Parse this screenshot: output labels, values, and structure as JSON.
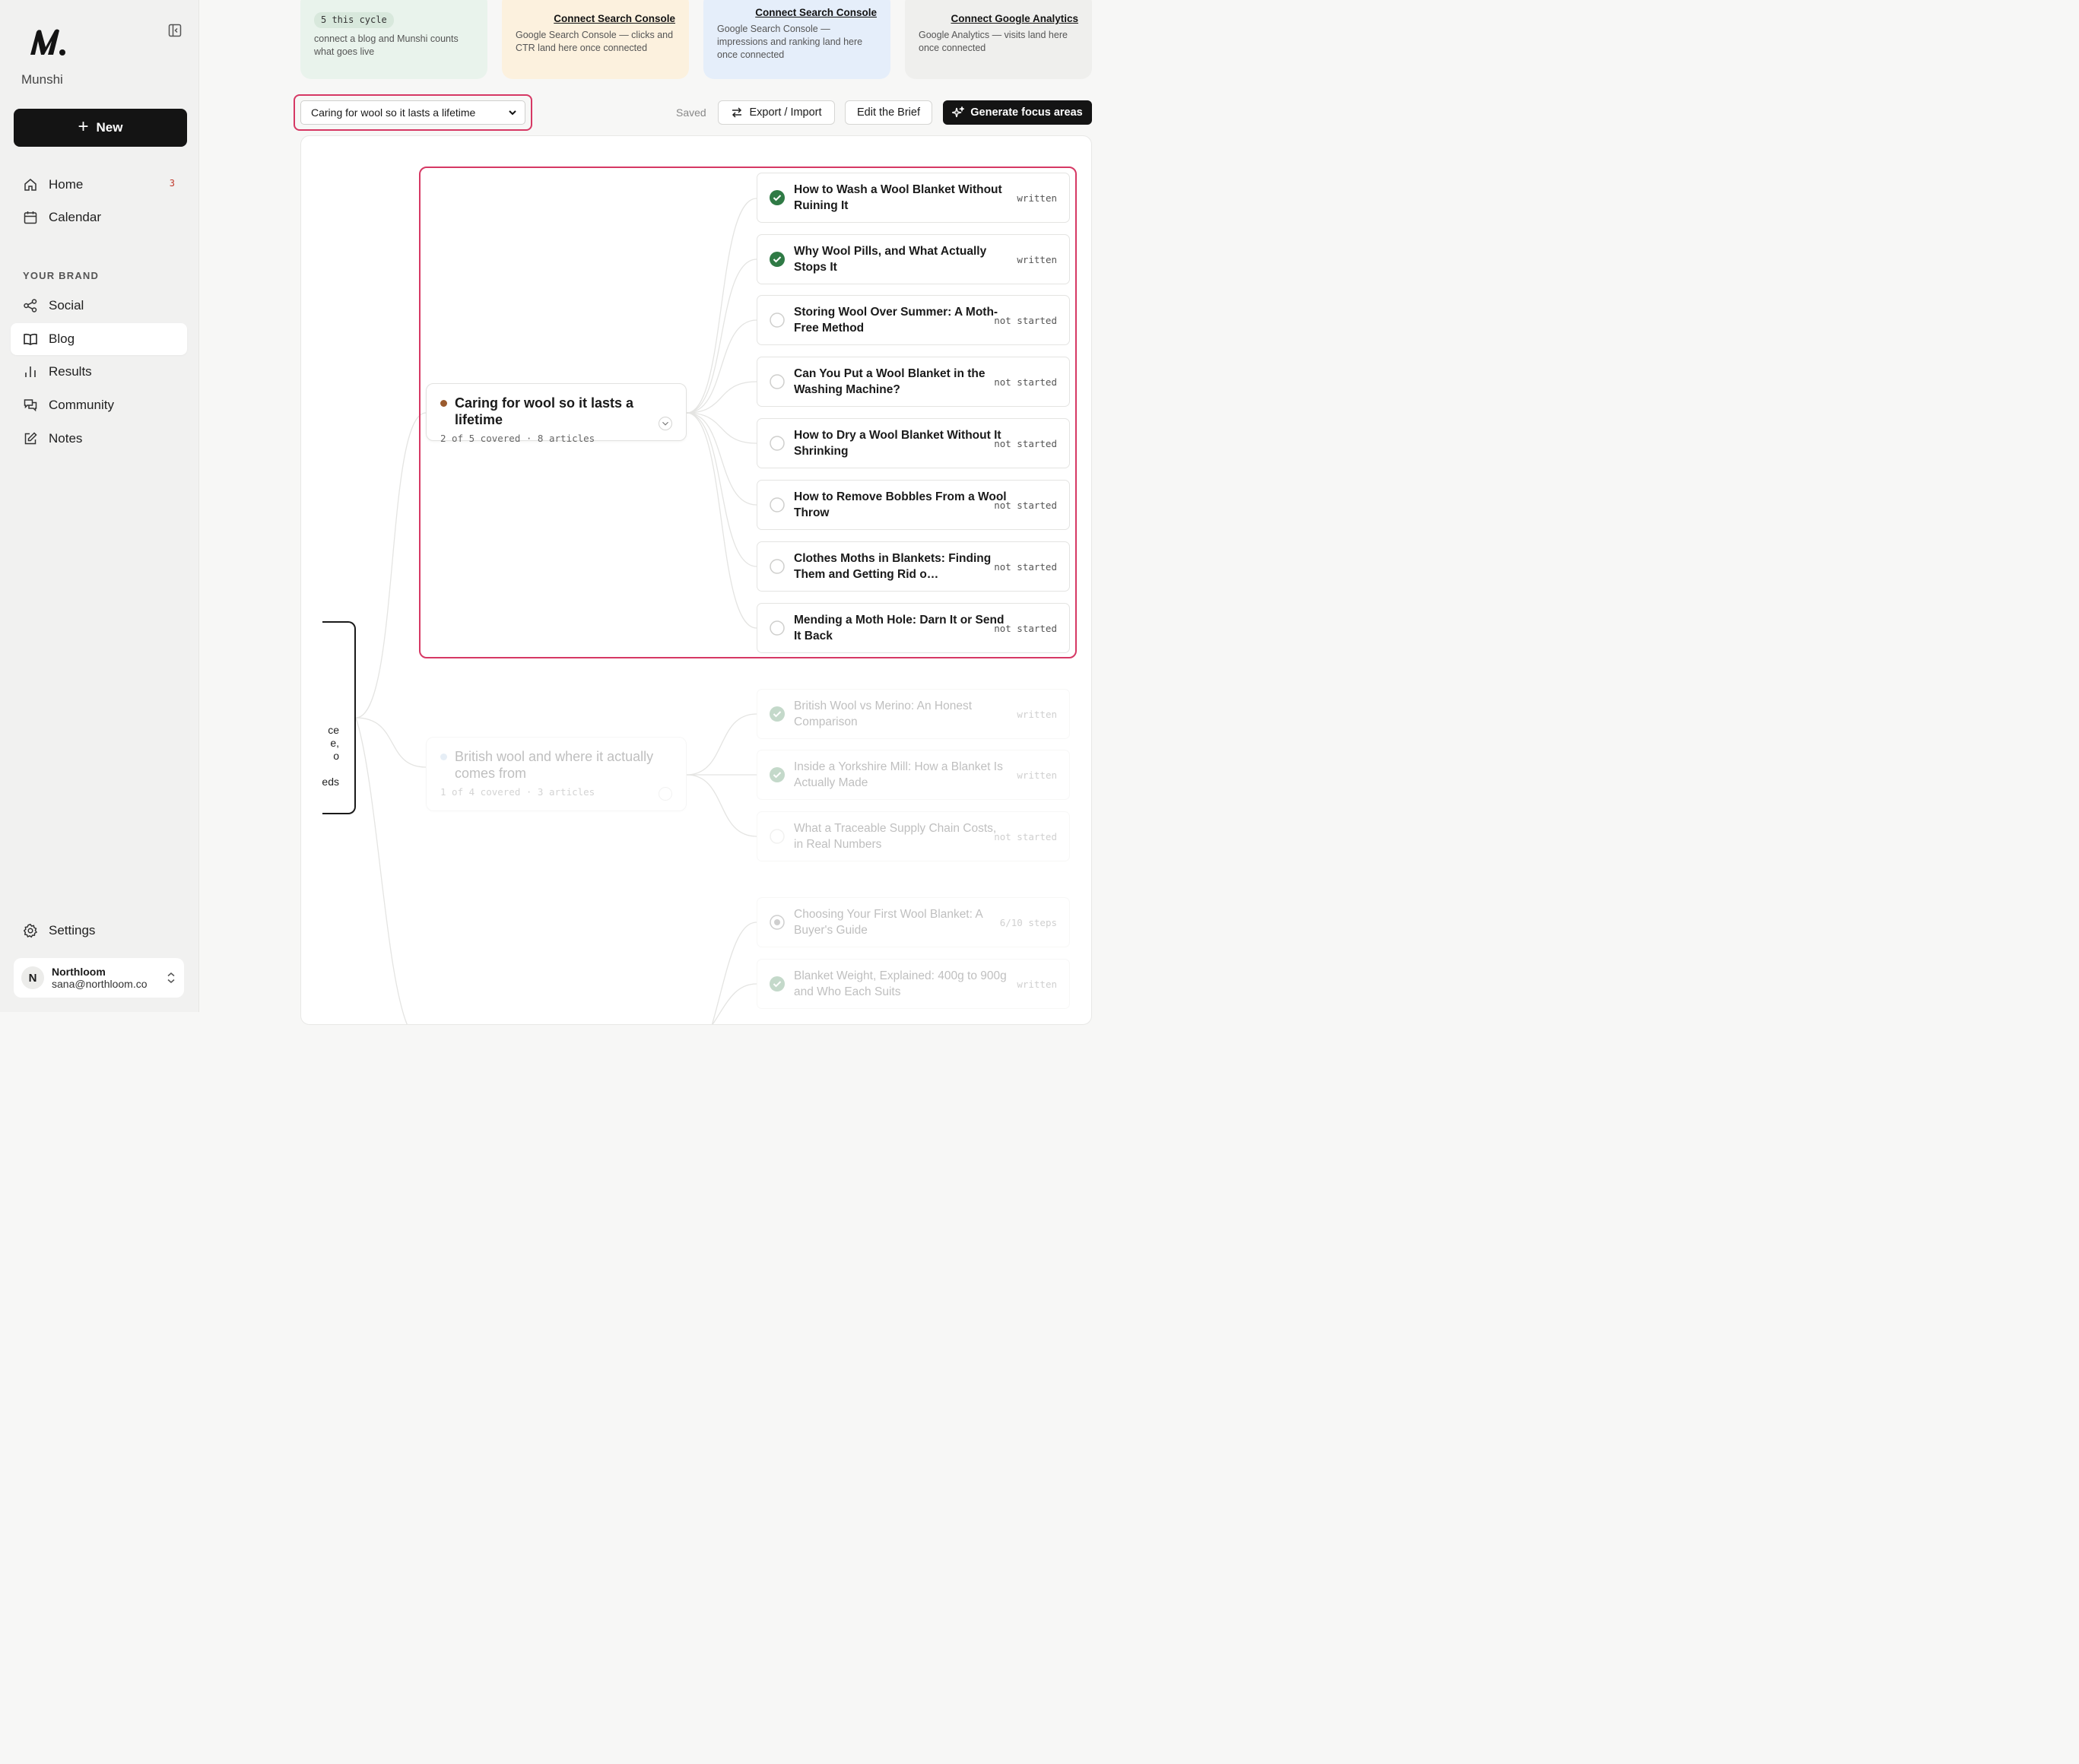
{
  "brand": {
    "name": "Munshi"
  },
  "sidebar": {
    "new_label": "New",
    "home": {
      "label": "Home",
      "badge": "3"
    },
    "calendar": {
      "label": "Calendar"
    },
    "section_label": "YOUR BRAND",
    "social": {
      "label": "Social"
    },
    "blog": {
      "label": "Blog"
    },
    "results": {
      "label": "Results"
    },
    "community": {
      "label": "Community"
    },
    "notes": {
      "label": "Notes"
    },
    "settings": {
      "label": "Settings"
    },
    "account": {
      "initial": "N",
      "name": "Northloom",
      "email": "sana@northloom.co"
    }
  },
  "cards": {
    "cycle": {
      "pill": "5 this cycle",
      "text": "connect a blog and Munshi counts what goes live"
    },
    "gsc_clicks": {
      "link": "Connect Search Console",
      "text": "Google Search Console — clicks and CTR land here once connected"
    },
    "gsc_impressions": {
      "link": "Connect Search Console",
      "text": "Google Search Console — impressions and ranking land here once connected"
    },
    "ga": {
      "link": "Connect Google Analytics",
      "text": "Google Analytics — visits land here once connected"
    }
  },
  "toolbar": {
    "select_value": "Caring for wool so it lasts a lifetime",
    "saved": "Saved",
    "export_label": "Export / Import",
    "brief_label": "Edit the Brief",
    "generate_label": "Generate focus areas"
  },
  "map": {
    "root_fragments": [
      "ce",
      "e,",
      "o",
      "eds"
    ],
    "focus1": {
      "title": "Caring for wool so it lasts a lifetime",
      "meta": "2 of 5 covered · 8 articles",
      "color": "#9a5a2e"
    },
    "focus2": {
      "title": "British wool and where it actually comes from",
      "meta": "1 of 4 covered · 3 articles",
      "color": "#a9c4e0"
    },
    "articles": [
      {
        "title": "How to Wash a Wool Blanket Without Ruining It",
        "status": "written"
      },
      {
        "title": "Why Wool Pills, and What Actually Stops It",
        "status": "written"
      },
      {
        "title": "Storing Wool Over Summer: A Moth-Free Method",
        "status": "not started"
      },
      {
        "title": "Can You Put a Wool Blanket in the Washing Machine?",
        "status": "not started"
      },
      {
        "title": "How to Dry a Wool Blanket Without It Shrinking",
        "status": "not started"
      },
      {
        "title": "How to Remove Bobbles From a Wool Throw",
        "status": "not started"
      },
      {
        "title": "Clothes Moths in Blankets: Finding Them and Getting Rid o…",
        "status": "not started"
      },
      {
        "title": "Mending a Moth Hole: Darn It or Send It Back",
        "status": "not started"
      }
    ],
    "articles2": [
      {
        "title": "British Wool vs Merino: An Honest Comparison",
        "status": "written"
      },
      {
        "title": "Inside a Yorkshire Mill: How a Blanket Is Actually Made",
        "status": "written"
      },
      {
        "title": "What a Traceable Supply Chain Costs, in Real Numbers",
        "status": "not started"
      }
    ],
    "articles3": [
      {
        "title": "Choosing Your First Wool Blanket: A Buyer's Guide",
        "status": "6/10 steps"
      },
      {
        "title": "Blanket Weight, Explained: 400g to 900g and Who Each Suits",
        "status": "written"
      }
    ]
  }
}
